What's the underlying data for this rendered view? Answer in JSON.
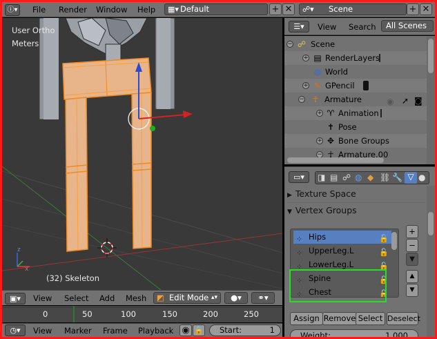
{
  "topbar": {
    "menu": [
      "File",
      "Render",
      "Window",
      "Help"
    ],
    "screen_layout": "Default",
    "scene": "Scene"
  },
  "viewport": {
    "view_name": "User Ortho",
    "units": "Meters",
    "object_info": "(32) Skeleton"
  },
  "viewport_header": {
    "view": "View",
    "select": "Select",
    "add": "Add",
    "mesh": "Mesh",
    "mode": "Edit Mode"
  },
  "ruler": {
    "ticks": [
      "0",
      "50",
      "100",
      "150",
      "200",
      "250"
    ]
  },
  "timeline_header": {
    "view": "View",
    "marker": "Marker",
    "frame": "Frame",
    "playback": "Playback",
    "start_label": "Start:",
    "start_value": "1"
  },
  "outliner": {
    "view": "View",
    "search": "Search",
    "display_mode": "All Scenes",
    "items": [
      {
        "label": "Scene",
        "icon": "scene-icon"
      },
      {
        "label": "RenderLayers",
        "icon": "render-layers-icon"
      },
      {
        "label": "World",
        "icon": "world-icon"
      },
      {
        "label": "GPencil",
        "icon": "grease-pencil-icon"
      },
      {
        "label": "Armature",
        "icon": "armature-icon"
      },
      {
        "label": "Animation",
        "icon": "animation-icon"
      },
      {
        "label": "Pose",
        "icon": "pose-icon"
      },
      {
        "label": "Bone Groups",
        "icon": "bone-groups-icon"
      },
      {
        "label": "Armature.00",
        "icon": "armature-data-icon"
      }
    ]
  },
  "properties": {
    "texture_space": "Texture Space",
    "vertex_groups": "Vertex Groups",
    "groups": [
      "Hips",
      "UpperLeg.L",
      "LowerLeg.L",
      "Spine",
      "Chest"
    ],
    "active_group": "Hips",
    "assign": "Assign",
    "remove": "Remove",
    "select": "Select",
    "deselect": "Deselect",
    "weight_label": "Weight:",
    "weight_value": "1.000"
  },
  "colors": {
    "selection_outline": "#ff1a1a",
    "highlight_box": "#22e022",
    "active_row": "#5680c2",
    "mesh_selected": "#e8b48a"
  }
}
